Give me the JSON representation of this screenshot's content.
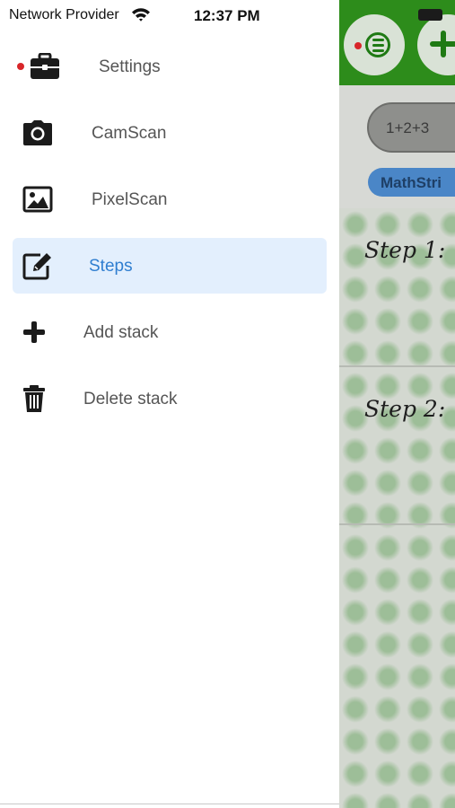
{
  "status_bar": {
    "carrier": "Network Provider",
    "time": "12:37 PM",
    "icons": [
      "wifi-icon",
      "battery-icon"
    ]
  },
  "drawer": {
    "items": [
      {
        "label": "Settings",
        "icon": "briefcase-icon",
        "badge": "notification-dot",
        "active": false
      },
      {
        "label": "CamScan",
        "icon": "camera-icon",
        "active": false
      },
      {
        "label": "PixelScan",
        "icon": "image-icon",
        "active": false
      },
      {
        "label": "Steps",
        "icon": "edit-icon",
        "active": true
      },
      {
        "label": "Add stack",
        "icon": "plus-icon",
        "active": false
      },
      {
        "label": "Delete stack",
        "icon": "trash-icon",
        "active": false
      }
    ]
  },
  "background_app": {
    "header_buttons": [
      "menu-icon",
      "add-icon"
    ],
    "expression": "1+2+3",
    "chip": "MathStri",
    "steps": [
      "Step 1:",
      "Step 2:"
    ]
  },
  "colors": {
    "header_green": "#2d8c1b",
    "accent_blue": "#2f7ed0",
    "active_bg": "#e3effd",
    "badge_red": "#d8262a"
  }
}
